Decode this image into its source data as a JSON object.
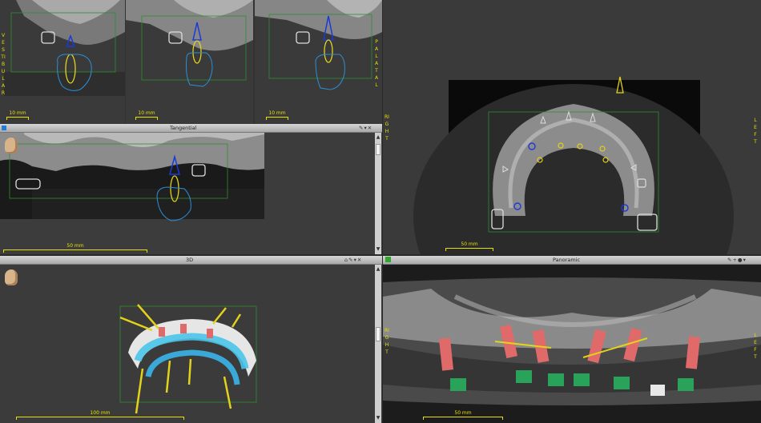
{
  "views": {
    "cross_1": {
      "scale_label": "10 mm"
    },
    "cross_2": {
      "scale_label": "10 mm"
    },
    "cross_3": {
      "scale_label": "10 mm"
    },
    "orient_left": "VESTIBULAR",
    "orient_right": "PALATAL",
    "tangential": {
      "title": "Tangential",
      "scale_label": "50 mm"
    },
    "axial": {
      "scale_label": "50 mm",
      "orient_right": "RIGHT",
      "orient_left": "LEFT"
    },
    "view3d": {
      "title": "3D",
      "scale_label": "100 mm"
    },
    "panoramic": {
      "title": "Panoramic",
      "scale_label": "50 mm",
      "orient_right": "RIGHT",
      "orient_left": "LEFT"
    }
  },
  "icons": {
    "head": "head-orientation-icon",
    "pin": "pin-icon",
    "menu": "menu-icon"
  },
  "colors": {
    "scale": "#e8e000",
    "implant_outline": "#1a3ad8",
    "bone_outline": "#2a8fd8",
    "implant_yellow": "#e3d21b",
    "crown_red": "#e06a6a",
    "abutment_green": "#29a35a",
    "bar_bg": "#c2c2c2"
  }
}
